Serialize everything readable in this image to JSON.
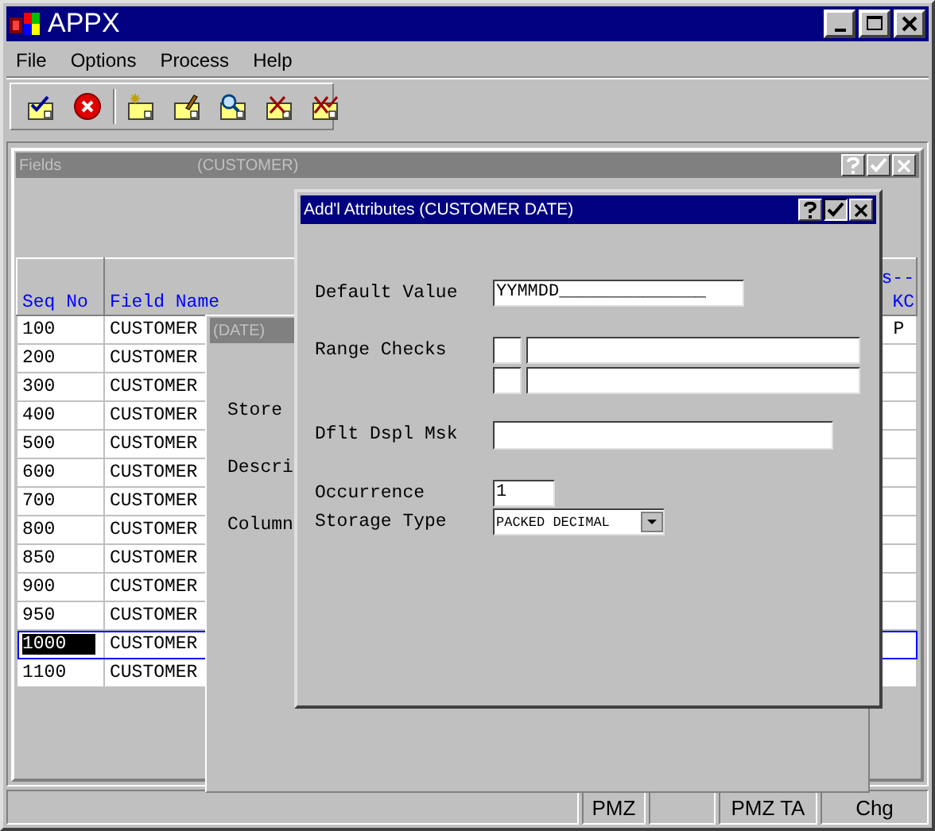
{
  "window": {
    "title": "APPX"
  },
  "menu": [
    {
      "label": "File"
    },
    {
      "label": "Options"
    },
    {
      "label": "Process"
    },
    {
      "label": "Help"
    }
  ],
  "toolbar": [
    {
      "kind": "ok"
    },
    {
      "kind": "cancel"
    },
    {
      "kind": "separator"
    },
    {
      "kind": "add"
    },
    {
      "kind": "edit"
    },
    {
      "kind": "inquire"
    },
    {
      "kind": "delete"
    },
    {
      "kind": "mass_delete"
    }
  ],
  "fields_window": {
    "title": "Fields",
    "subtitle": "(CUSTOMER)",
    "active": false,
    "columns": [
      {
        "label": "Seq No"
      },
      {
        "label": "Field Name"
      },
      {
        "label": "KC",
        "group_fragment": "s--"
      }
    ],
    "rows": [
      {
        "seq": "100",
        "name": "CUSTOMER",
        "kc": "P",
        "selected": false
      },
      {
        "seq": "200",
        "name": "CUSTOMER",
        "selected": false
      },
      {
        "seq": "300",
        "name": "CUSTOMER",
        "selected": false
      },
      {
        "seq": "400",
        "name": "CUSTOMER",
        "selected": false
      },
      {
        "seq": "500",
        "name": "CUSTOMER",
        "selected": false
      },
      {
        "seq": "600",
        "name": "CUSTOMER",
        "selected": false
      },
      {
        "seq": "700",
        "name": "CUSTOMER",
        "selected": false
      },
      {
        "seq": "800",
        "name": "CUSTOMER",
        "selected": false
      },
      {
        "seq": "850",
        "name": "CUSTOMER",
        "selected": false
      },
      {
        "seq": "900",
        "name": "CUSTOMER",
        "selected": false
      },
      {
        "seq": "950",
        "name": "CUSTOMER",
        "selected": false
      },
      {
        "seq": "1000",
        "name": "CUSTOMER",
        "selected": true
      },
      {
        "seq": "1100",
        "name": "CUSTOMER",
        "selected": false
      }
    ]
  },
  "date_window": {
    "title": "(DATE)",
    "active": false,
    "labels": [
      "Store",
      "Descri",
      "Column"
    ]
  },
  "dialog": {
    "title": "Add'l Attributes (CUSTOMER DATE)",
    "active": true,
    "fields": [
      {
        "kind": "text",
        "label": "Default Value",
        "value": "YYMMDD______________"
      },
      {
        "kind": "range",
        "label": "Range Checks"
      },
      {
        "kind": "text",
        "label": "Dflt Dspl Msk"
      },
      {
        "kind": "text",
        "label": "Occurrence",
        "value": "1"
      },
      {
        "kind": "select",
        "label": "Storage Type",
        "value": "PACKED DECIMAL"
      }
    ]
  },
  "status_bar": [
    {
      "kind": "blank"
    },
    {
      "kind": "text",
      "text": "PMZ"
    },
    {
      "kind": "blank"
    },
    {
      "kind": "text",
      "text": "PMZ TA"
    },
    {
      "kind": "text",
      "text": "Chg"
    }
  ]
}
